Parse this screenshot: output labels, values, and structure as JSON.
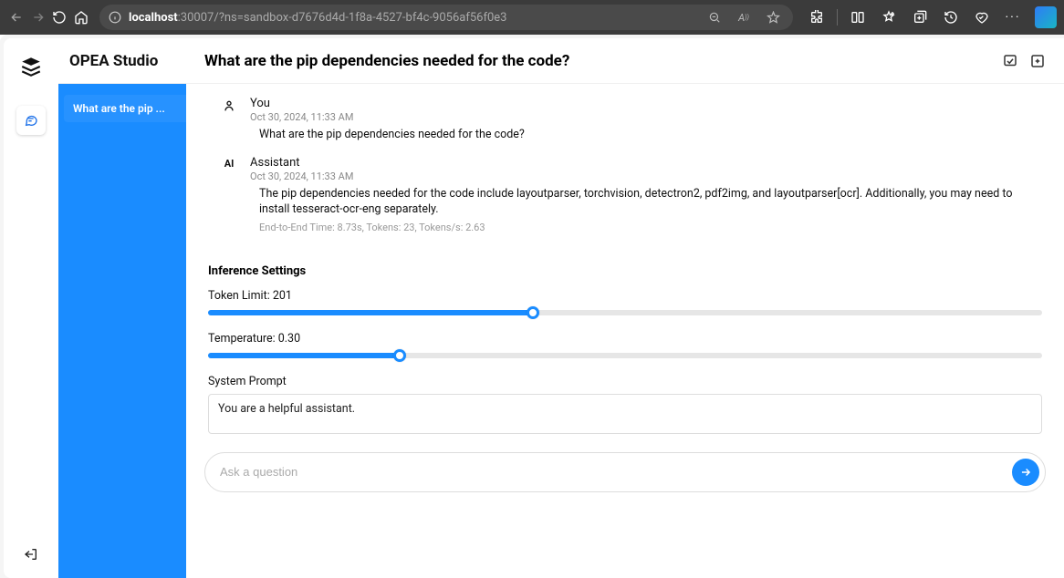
{
  "browser": {
    "url_prefix": "localhost",
    "url_suffix": ":30007/?ns=sandbox-d7676d4d-1f8a-4527-bf4c-9056af56f0e3"
  },
  "app": {
    "title": "OPEA Studio"
  },
  "sidebar": {
    "conversations": [
      {
        "label": "What are the pip ..."
      }
    ]
  },
  "header": {
    "title": "What are the pip dependencies needed for the code?"
  },
  "chat": {
    "messages": [
      {
        "role": "user",
        "author": "You",
        "time": "Oct 30, 2024, 11:33 AM",
        "text": "What are the pip dependencies needed for the code?"
      },
      {
        "role": "assistant",
        "author": "Assistant",
        "time": "Oct 30, 2024, 11:33 AM",
        "text": "The pip dependencies needed for the code include layoutparser, torchvision, detectron2, pdf2img, and layoutparser[ocr]. Additionally, you may need to install tesseract-ocr-eng separately.",
        "meta": "End-to-End Time: 8.73s, Tokens: 23, Tokens/s: 2.63"
      }
    ]
  },
  "settings": {
    "title": "Inference Settings",
    "token_limit": {
      "label": "Token Limit: 201",
      "value": 201,
      "min": 0,
      "max": 512,
      "percent": 39
    },
    "temperature": {
      "label": "Temperature: 0.30",
      "value": 0.3,
      "min": 0,
      "max": 1.3,
      "percent": 23
    },
    "system_prompt": {
      "label": "System Prompt",
      "value": "You are a helpful assistant."
    }
  },
  "composer": {
    "placeholder": "Ask a question"
  }
}
